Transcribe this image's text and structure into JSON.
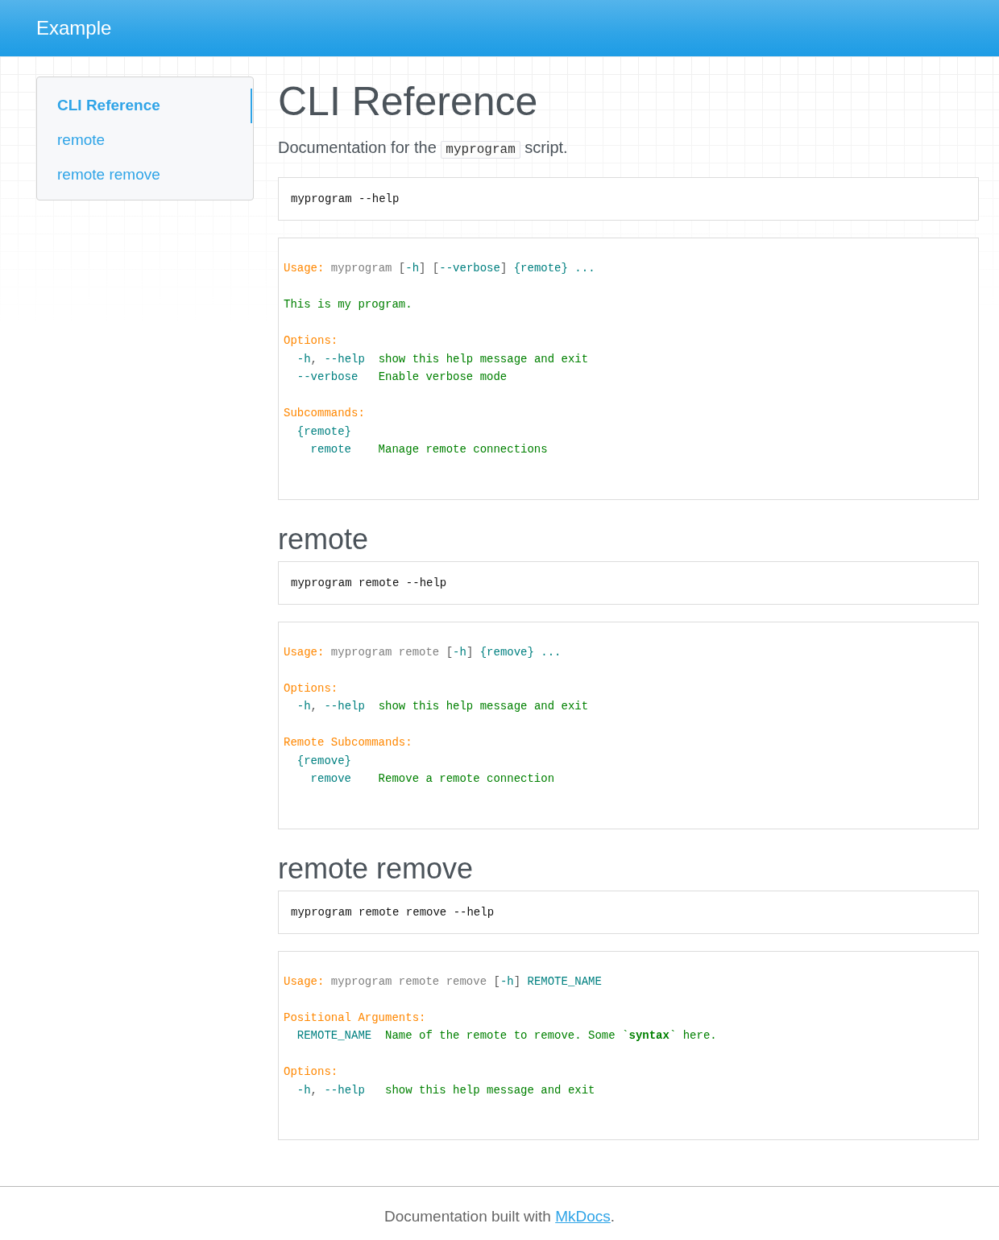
{
  "header": {
    "title": "Example"
  },
  "sidebar": {
    "items": [
      {
        "label": "CLI Reference",
        "selected": true
      },
      {
        "label": "remote",
        "selected": false
      },
      {
        "label": "remote remove",
        "selected": false
      }
    ]
  },
  "page": {
    "title": "CLI Reference",
    "intro": {
      "before": "Documentation for the",
      "code": "myprogram",
      "after": "script."
    }
  },
  "sections": [
    {
      "command": "myprogram --help",
      "output": [
        [
          {
            "kind": "top",
            "segments": [
              {
                "kind": "label",
                "text": "Usage:"
              },
              {
                "kind": "prog",
                "text": " myprogram "
              },
              {
                "kind": "punct",
                "text": "["
              },
              {
                "kind": "flag",
                "text": "-h"
              },
              {
                "kind": "punct",
                "text": "] ["
              },
              {
                "kind": "flag",
                "text": "--verbose"
              },
              {
                "kind": "punct",
                "text": "]"
              },
              {
                "kind": "flag",
                "text": " {remote} ..."
              }
            ]
          }
        ],
        [
          {
            "kind": "top",
            "segments": [
              {
                "kind": "text",
                "text": "This is my program."
              }
            ]
          }
        ],
        [
          {
            "kind": "top",
            "segments": [
              {
                "kind": "label",
                "text": "Options:"
              }
            ]
          },
          {
            "kind": "item",
            "segments": [
              {
                "kind": "flag",
                "text": "-h"
              },
              {
                "kind": "punct",
                "text": ", "
              },
              {
                "kind": "flag",
                "text": "--help"
              },
              {
                "kind": "text",
                "text": "  show this help message and exit"
              }
            ]
          },
          {
            "kind": "item",
            "segments": [
              {
                "kind": "flag",
                "text": "--verbose"
              },
              {
                "kind": "text",
                "text": "   Enable verbose mode"
              }
            ]
          }
        ],
        [
          {
            "kind": "top",
            "segments": [
              {
                "kind": "label",
                "text": "Subcommands:"
              }
            ]
          },
          {
            "kind": "item",
            "segments": [
              {
                "kind": "flag",
                "text": "{remote}"
              }
            ]
          },
          {
            "kind": "subitem",
            "segments": [
              {
                "kind": "flag",
                "text": "remote"
              },
              {
                "kind": "text",
                "text": "    Manage remote connections"
              }
            ]
          }
        ]
      ]
    },
    {
      "heading": "remote",
      "command": "myprogram remote --help",
      "output": [
        [
          {
            "kind": "top",
            "segments": [
              {
                "kind": "label",
                "text": "Usage:"
              },
              {
                "kind": "prog",
                "text": " myprogram remote "
              },
              {
                "kind": "punct",
                "text": "["
              },
              {
                "kind": "flag",
                "text": "-h"
              },
              {
                "kind": "punct",
                "text": "]"
              },
              {
                "kind": "flag",
                "text": " {remove} ..."
              }
            ]
          }
        ],
        [
          {
            "kind": "top",
            "segments": [
              {
                "kind": "label",
                "text": "Options:"
              }
            ]
          },
          {
            "kind": "item",
            "segments": [
              {
                "kind": "flag",
                "text": "-h"
              },
              {
                "kind": "punct",
                "text": ", "
              },
              {
                "kind": "flag",
                "text": "--help"
              },
              {
                "kind": "text",
                "text": "  show this help message and exit"
              }
            ]
          }
        ],
        [
          {
            "kind": "top",
            "segments": [
              {
                "kind": "label",
                "text": "Remote Subcommands:"
              }
            ]
          },
          {
            "kind": "item",
            "segments": [
              {
                "kind": "flag",
                "text": "{remove}"
              }
            ]
          },
          {
            "kind": "subitem",
            "segments": [
              {
                "kind": "flag",
                "text": "remove"
              },
              {
                "kind": "text",
                "text": "    Remove a remote connection"
              }
            ]
          }
        ]
      ]
    },
    {
      "heading": "remote remove",
      "command": "myprogram remote remove --help",
      "output": [
        [
          {
            "kind": "top",
            "segments": [
              {
                "kind": "label",
                "text": "Usage:"
              },
              {
                "kind": "prog",
                "text": " myprogram remote remove "
              },
              {
                "kind": "punct",
                "text": "["
              },
              {
                "kind": "flag",
                "text": "-h"
              },
              {
                "kind": "punct",
                "text": "]"
              },
              {
                "kind": "flag",
                "text": " REMOTE_NAME"
              }
            ]
          }
        ],
        [
          {
            "kind": "top",
            "segments": [
              {
                "kind": "label",
                "text": "Positional Arguments:"
              }
            ]
          },
          {
            "kind": "item",
            "segments": [
              {
                "kind": "flag",
                "text": "REMOTE_NAME"
              },
              {
                "kind": "text",
                "text": "  Name of the remote to remove. Some `**syntax**` here."
              }
            ]
          }
        ],
        [
          {
            "kind": "top",
            "segments": [
              {
                "kind": "label",
                "text": "Options:"
              }
            ]
          },
          {
            "kind": "item",
            "segments": [
              {
                "kind": "flag",
                "text": "-h"
              },
              {
                "kind": "punct",
                "text": ", "
              },
              {
                "kind": "flag",
                "text": "--help"
              },
              {
                "kind": "text",
                "text": "   show this help message and exit"
              }
            ]
          }
        ]
      ]
    }
  ],
  "footer": {
    "before": "Documentation built with",
    "link": "MkDocs",
    "after": "."
  }
}
